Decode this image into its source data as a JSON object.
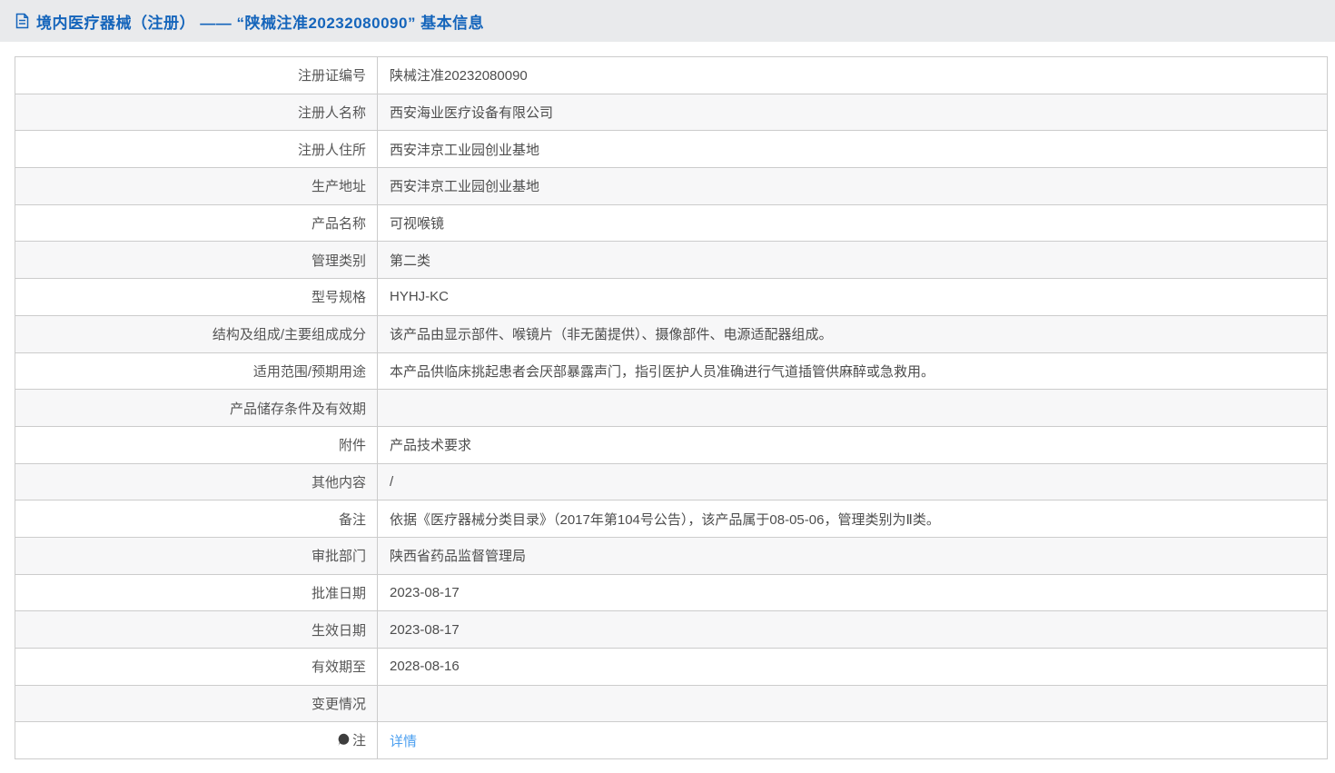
{
  "header": {
    "title": "境内医疗器械（注册） —— “陕械注准20232080090” 基本信息",
    "icon": "document-icon"
  },
  "table": {
    "rows": [
      {
        "label": "注册证编号",
        "value": "陕械注准20232080090"
      },
      {
        "label": "注册人名称",
        "value": "西安海业医疗设备有限公司"
      },
      {
        "label": "注册人住所",
        "value": "西安沣京工业园创业基地"
      },
      {
        "label": "生产地址",
        "value": "西安沣京工业园创业基地"
      },
      {
        "label": "产品名称",
        "value": "可视喉镜"
      },
      {
        "label": "管理类别",
        "value": "第二类"
      },
      {
        "label": "型号规格",
        "value": "HYHJ-KC"
      },
      {
        "label": "结构及组成/主要组成成分",
        "value": "该产品由显示部件、喉镜片（非无菌提供）、摄像部件、电源适配器组成。"
      },
      {
        "label": "适用范围/预期用途",
        "value": "本产品供临床挑起患者会厌部暴露声门，指引医护人员准确进行气道插管供麻醉或急救用。"
      },
      {
        "label": "产品储存条件及有效期",
        "value": ""
      },
      {
        "label": "附件",
        "value": "产品技术要求"
      },
      {
        "label": "其他内容",
        "value": "/"
      },
      {
        "label": "备注",
        "value": "依据《医疗器械分类目录》（2017年第104号公告），该产品属于08-05-06，管理类别为Ⅱ类。"
      },
      {
        "label": "审批部门",
        "value": "陕西省药品监督管理局"
      },
      {
        "label": "批准日期",
        "value": "2023-08-17"
      },
      {
        "label": "生效日期",
        "value": "2023-08-17"
      },
      {
        "label": "有效期至",
        "value": "2028-08-16"
      },
      {
        "label": "变更情况",
        "value": ""
      },
      {
        "label": "注",
        "value": "详情",
        "value_is_link": true,
        "label_icon": "bulb-icon"
      }
    ]
  },
  "colors": {
    "header_bg": "#e9eaec",
    "header_text": "#1565bb",
    "link": "#4da0f0",
    "row_alt_bg": "#f7f7f8",
    "border": "#cccccc",
    "label_text": "#555555",
    "value_text": "#4d4d4d"
  }
}
